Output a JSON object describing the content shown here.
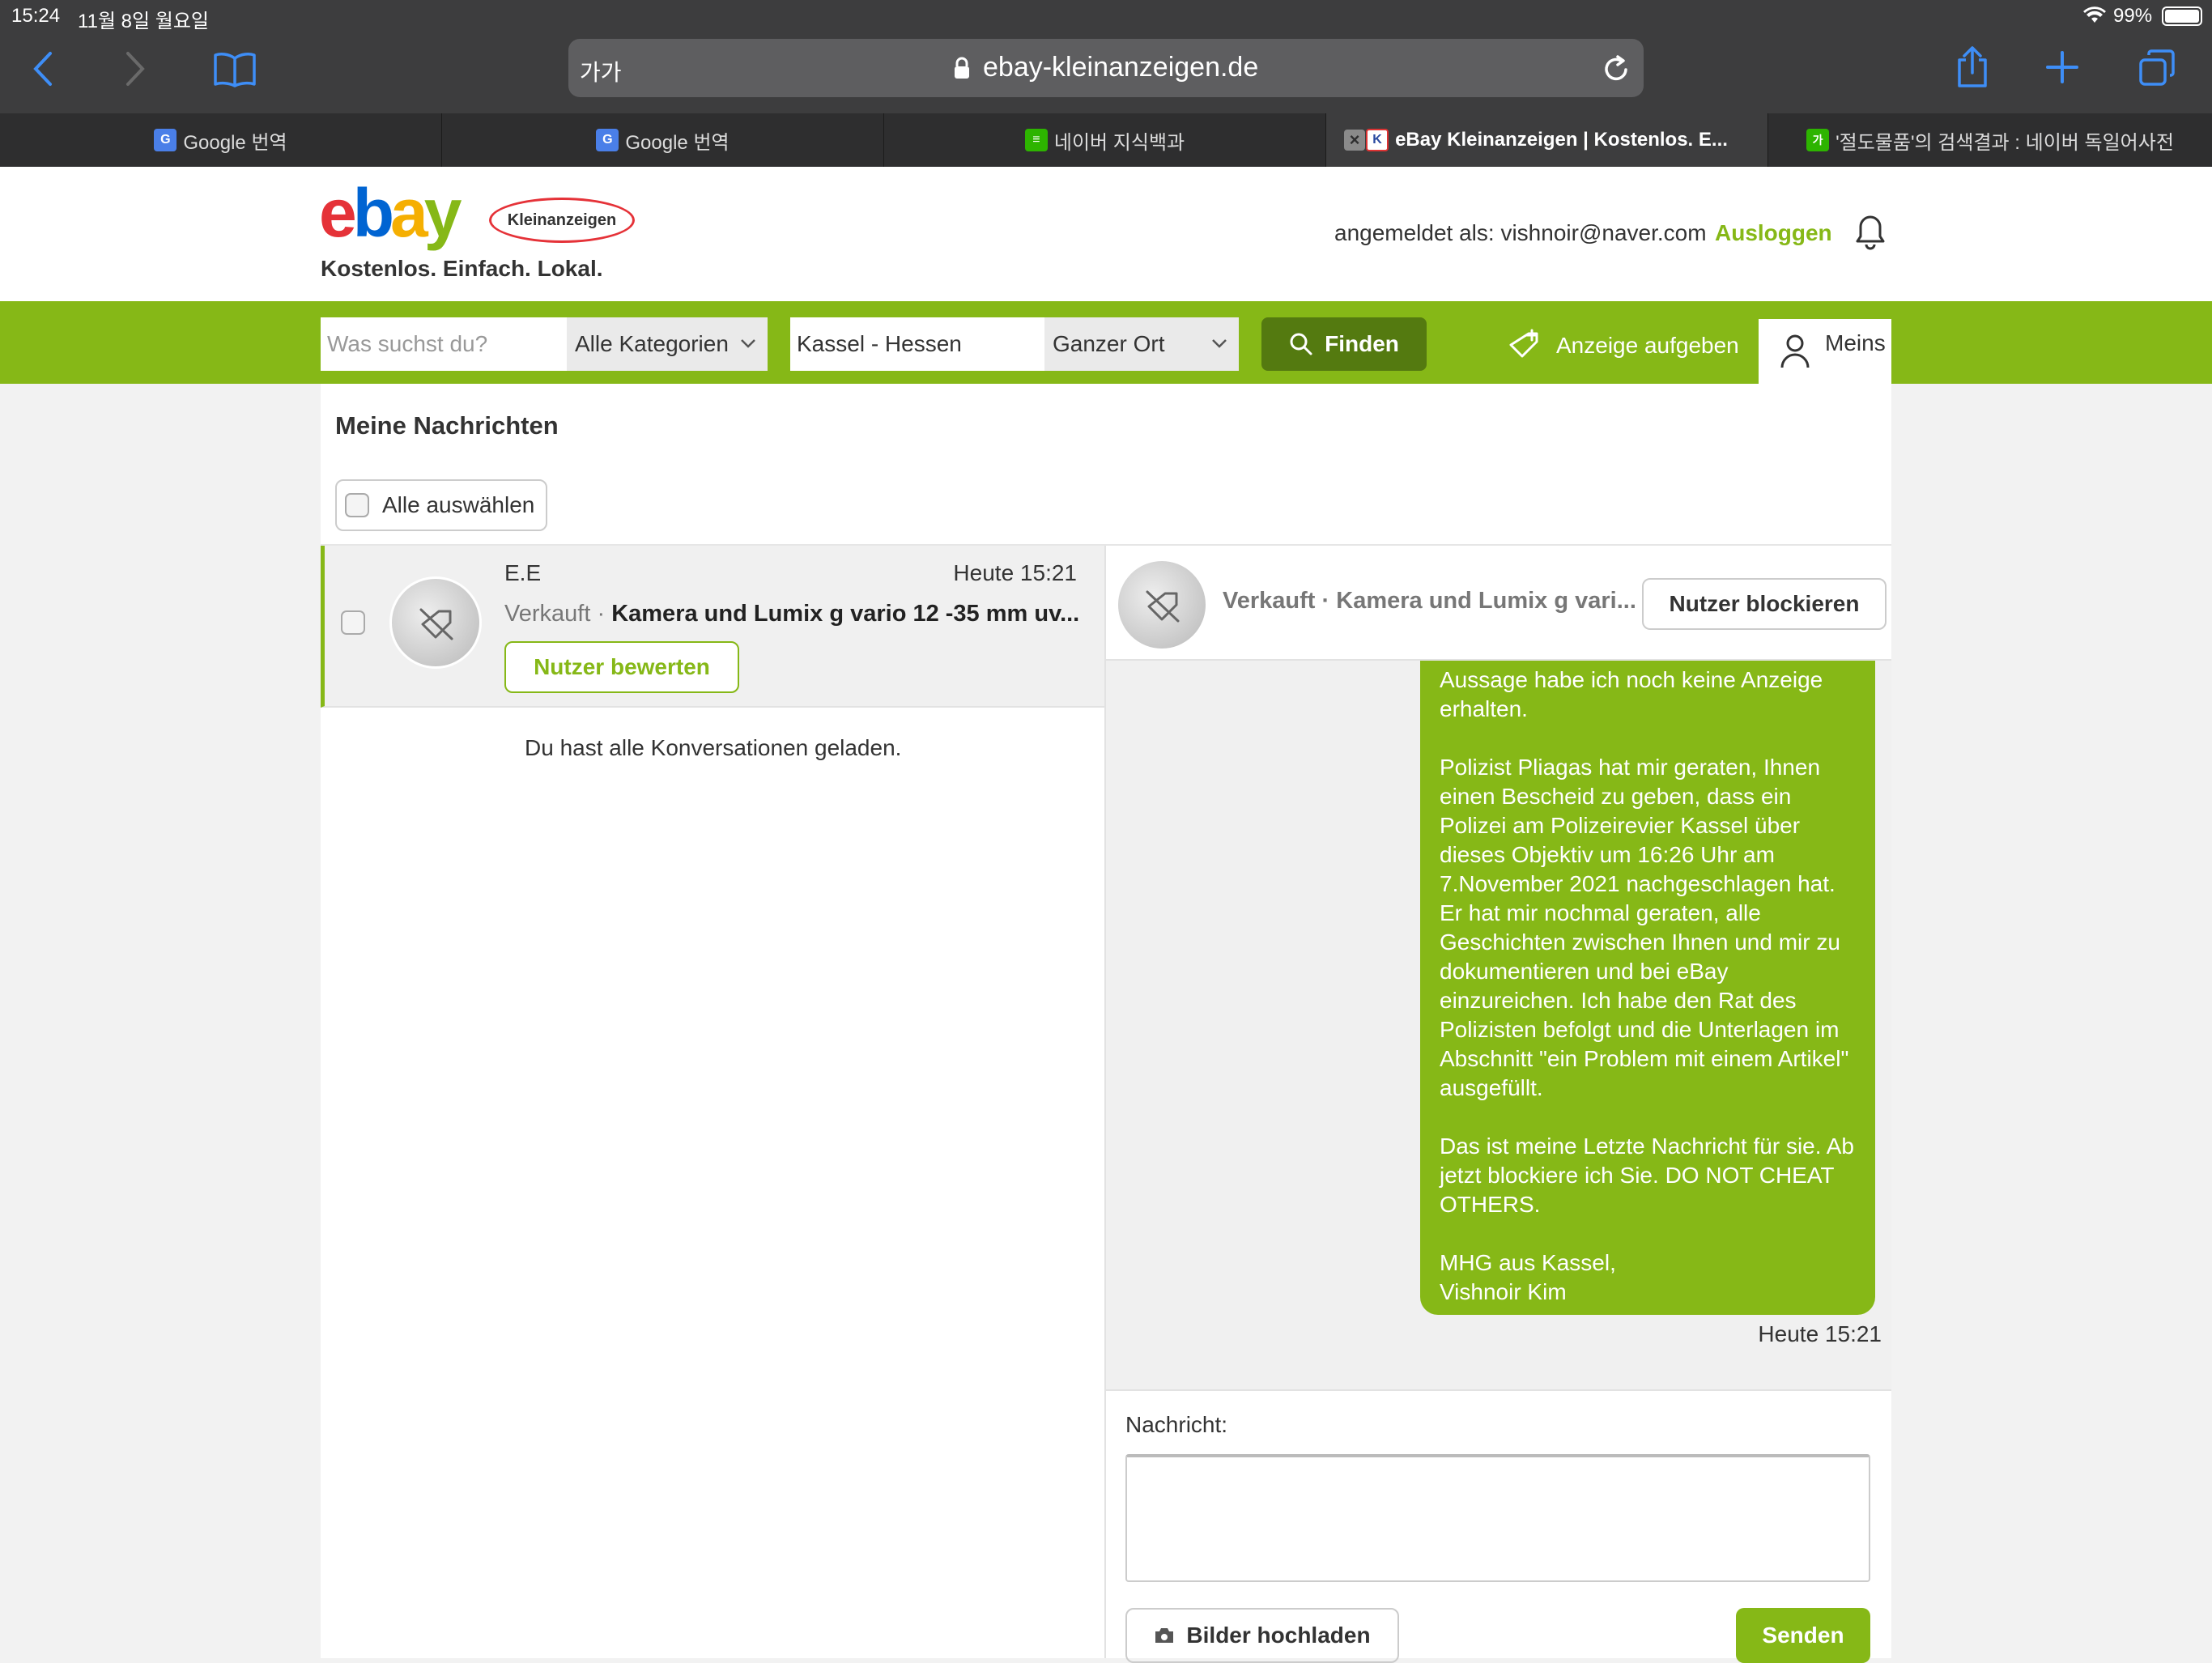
{
  "status": {
    "time": "15:24",
    "date": "11월 8일 월요일",
    "battery": "99%"
  },
  "browser": {
    "aa_label": "가가",
    "url": "ebay-kleinanzeigen.de",
    "tabs": [
      {
        "label": "Google 번역",
        "icon": "google-translate-icon"
      },
      {
        "label": "Google 번역",
        "icon": "google-translate-icon"
      },
      {
        "label": "네이버 지식백과",
        "icon": "naver-encyclopedia-icon"
      },
      {
        "label": "eBay Kleinanzeigen | Kostenlos. E...",
        "icon": "ebay-k-icon"
      },
      {
        "label": "'절도물품'의 검색결과 : 네이버 독일어사전",
        "icon": "naver-dictionary-icon"
      }
    ]
  },
  "header": {
    "logo": "ebay",
    "logo_badge": "Kleinanzeigen",
    "tagline": "Kostenlos. Einfach. Lokal.",
    "logged_in_as": "angemeldet als: vishnoir@naver.com",
    "logout": "Ausloggen"
  },
  "search": {
    "query_placeholder": "Was suchst du?",
    "category": "Alle Kategorien",
    "location": "Kassel - Hessen",
    "radius": "Ganzer Ort",
    "find_button": "Finden",
    "post_ad": "Anzeige aufgeben",
    "mine": "Meins"
  },
  "messages": {
    "title": "Meine Nachrichten",
    "select_all": "Alle auswählen",
    "conversation": {
      "name": "E.E",
      "time": "Heute 15:21",
      "status": "Verkauft",
      "separator": "·",
      "subject": "Kamera und Lumix g vario 12 -35 mm uv...",
      "rate_button": "Nutzer bewerten"
    },
    "all_loaded": "Du hast alle Konversationen geladen."
  },
  "chat": {
    "status": "Verkauft",
    "separator": "·",
    "subject": "Kamera und Lumix g vari...",
    "block_button": "Nutzer blockieren",
    "message_paragraphs": [
      "Aussage habe ich noch keine Anzeige erhalten.",
      "Polizist Pliagas hat mir geraten, Ihnen einen Bescheid zu geben, dass ein Polizei am Polizeirevier Kassel über dieses Objektiv um 16:26 Uhr am 7.November 2021 nachgeschlagen hat. Er hat mir nochmal geraten, alle Geschichten zwischen Ihnen und mir zu dokumentieren und bei eBay einzureichen. Ich habe den Rat des Polizisten befolgt und die Unterlagen im Abschnitt \"ein Problem mit einem Artikel\" ausgefüllt.",
      "Das ist meine Letzte Nachricht für sie. Ab jetzt blockiere ich Sie. DO NOT CHEAT OTHERS.",
      "MHG aus Kassel,\nVishnoir Kim"
    ],
    "message_time": "Heute 15:21",
    "compose_label": "Nachricht:",
    "compose_value": "",
    "upload_button": "Bilder hochladen",
    "send_button": "Senden"
  },
  "colors": {
    "accent": "#86b817",
    "chrome": "#3d3d3e",
    "safari_blue": "#3e8ef7"
  }
}
